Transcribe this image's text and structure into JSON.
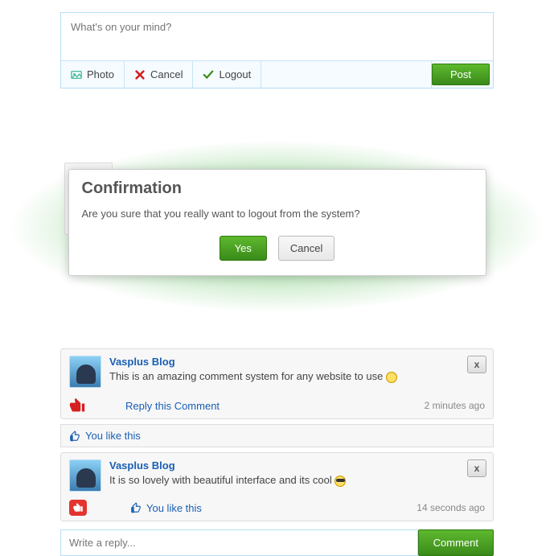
{
  "composer": {
    "placeholder": "What's on your mind?",
    "photo": "Photo",
    "cancel": "Cancel",
    "logout": "Logout",
    "post": "Post"
  },
  "modal": {
    "title": "Confirmation",
    "message": "Are you sure that you really want to logout from the system?",
    "yes": "Yes",
    "cancel": "Cancel"
  },
  "comment": {
    "author": "Vasplus Blog",
    "text": "This is an amazing comment system for any website to use ",
    "reply_link": "Reply this Comment",
    "timestamp": "2 minutes ago",
    "close": "x"
  },
  "like_bar": "You like this",
  "reply": {
    "author": "Vasplus Blog",
    "text": "It is so lovely with beautiful interface and its cool ",
    "like_text": "You like this",
    "timestamp": "14 seconds ago",
    "close": "x"
  },
  "reply_input": {
    "placeholder": "Write a reply...",
    "button": "Comment"
  }
}
